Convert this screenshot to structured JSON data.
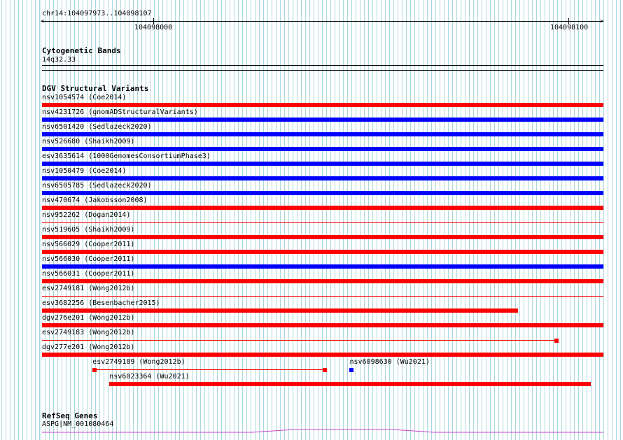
{
  "ruler": {
    "range_label": "chr14:104097973..104098107",
    "ticks": [
      "104098000",
      "104098100"
    ]
  },
  "cytoband": {
    "title": "Cytogenetic Bands",
    "band": "14q32.33"
  },
  "dgv": {
    "title": "DGV Structural Variants",
    "colors": {
      "red": "#ff0000",
      "blue": "#0000ff"
    },
    "rows": [
      {
        "label": "nsv1054574 (Coe2014)",
        "color": "red",
        "style": "bar",
        "start": 0,
        "end": 1
      },
      {
        "label": "nsv4231726 (gnomADStructuralVariants)",
        "color": "blue",
        "style": "bar",
        "start": 0,
        "end": 1
      },
      {
        "label": "nsv6501420 (Sedlazeck2020)",
        "color": "blue",
        "style": "bar",
        "start": 0,
        "end": 1
      },
      {
        "label": "nsv526680 (Shaikh2009)",
        "color": "blue",
        "style": "bar",
        "start": 0,
        "end": 1
      },
      {
        "label": "esv3635614 (1000GenomesConsortiumPhase3)",
        "color": "blue",
        "style": "bar",
        "start": 0,
        "end": 1
      },
      {
        "label": "nsv1050479 (Coe2014)",
        "color": "blue",
        "style": "bar",
        "start": 0,
        "end": 1
      },
      {
        "label": "nsv6505785 (Sedlazeck2020)",
        "color": "blue",
        "style": "bar",
        "start": 0,
        "end": 1
      },
      {
        "label": "nsv470674 (Jakobsson2008)",
        "color": "red",
        "style": "bar",
        "start": 0,
        "end": 1
      },
      {
        "label": "nsv952262 (Dogan2014)",
        "color": "red",
        "style": "line",
        "start": 0,
        "end": 1
      },
      {
        "label": "nsv519605 (Shaikh2009)",
        "color": "red",
        "style": "bar",
        "start": 0,
        "end": 1
      },
      {
        "label": "nsv566029 (Cooper2011)",
        "color": "red",
        "style": "bar",
        "start": 0,
        "end": 1
      },
      {
        "label": "nsv566030 (Cooper2011)",
        "color": "blue",
        "style": "bar",
        "start": 0,
        "end": 1
      },
      {
        "label": "nsv566031 (Cooper2011)",
        "color": "red",
        "style": "bar",
        "start": 0,
        "end": 1
      },
      {
        "label": "esv2749181 (Wong2012b)",
        "color": "red",
        "style": "line",
        "start": 0,
        "end": 1
      },
      {
        "label": "esv3682256 (Besenbacher2015)",
        "color": "red",
        "style": "bar",
        "start": 0,
        "end": 0.848
      },
      {
        "label": "dgv276e201 (Wong2012b)",
        "color": "red",
        "style": "bar",
        "start": 0,
        "end": 1
      },
      {
        "label": "esv2749183 (Wong2012b)",
        "color": "red",
        "style": "line-box",
        "start": 0,
        "end": 0.92
      },
      {
        "label": "dgv277e201 (Wong2012b)",
        "color": "red",
        "style": "bar",
        "start": 0,
        "end": 1
      }
    ],
    "extra": [
      {
        "label": "esv2749189 (Wong2012b)",
        "color": "red",
        "style": "line-box-both",
        "start": 0.09,
        "end": 0.508,
        "row": 0
      },
      {
        "label": "nsv6098630 (Wu2021)",
        "color": "blue",
        "style": "point",
        "start": 0.548,
        "end": 0.555,
        "row": 0
      },
      {
        "label": "nsv6023364 (Wu2021)",
        "color": "red",
        "style": "bar",
        "start": 0.12,
        "end": 0.978,
        "row": 1
      }
    ]
  },
  "refseq": {
    "title": "RefSeq Genes",
    "gene": "ASPG|NM_001080464",
    "color": "#cc44cc"
  }
}
